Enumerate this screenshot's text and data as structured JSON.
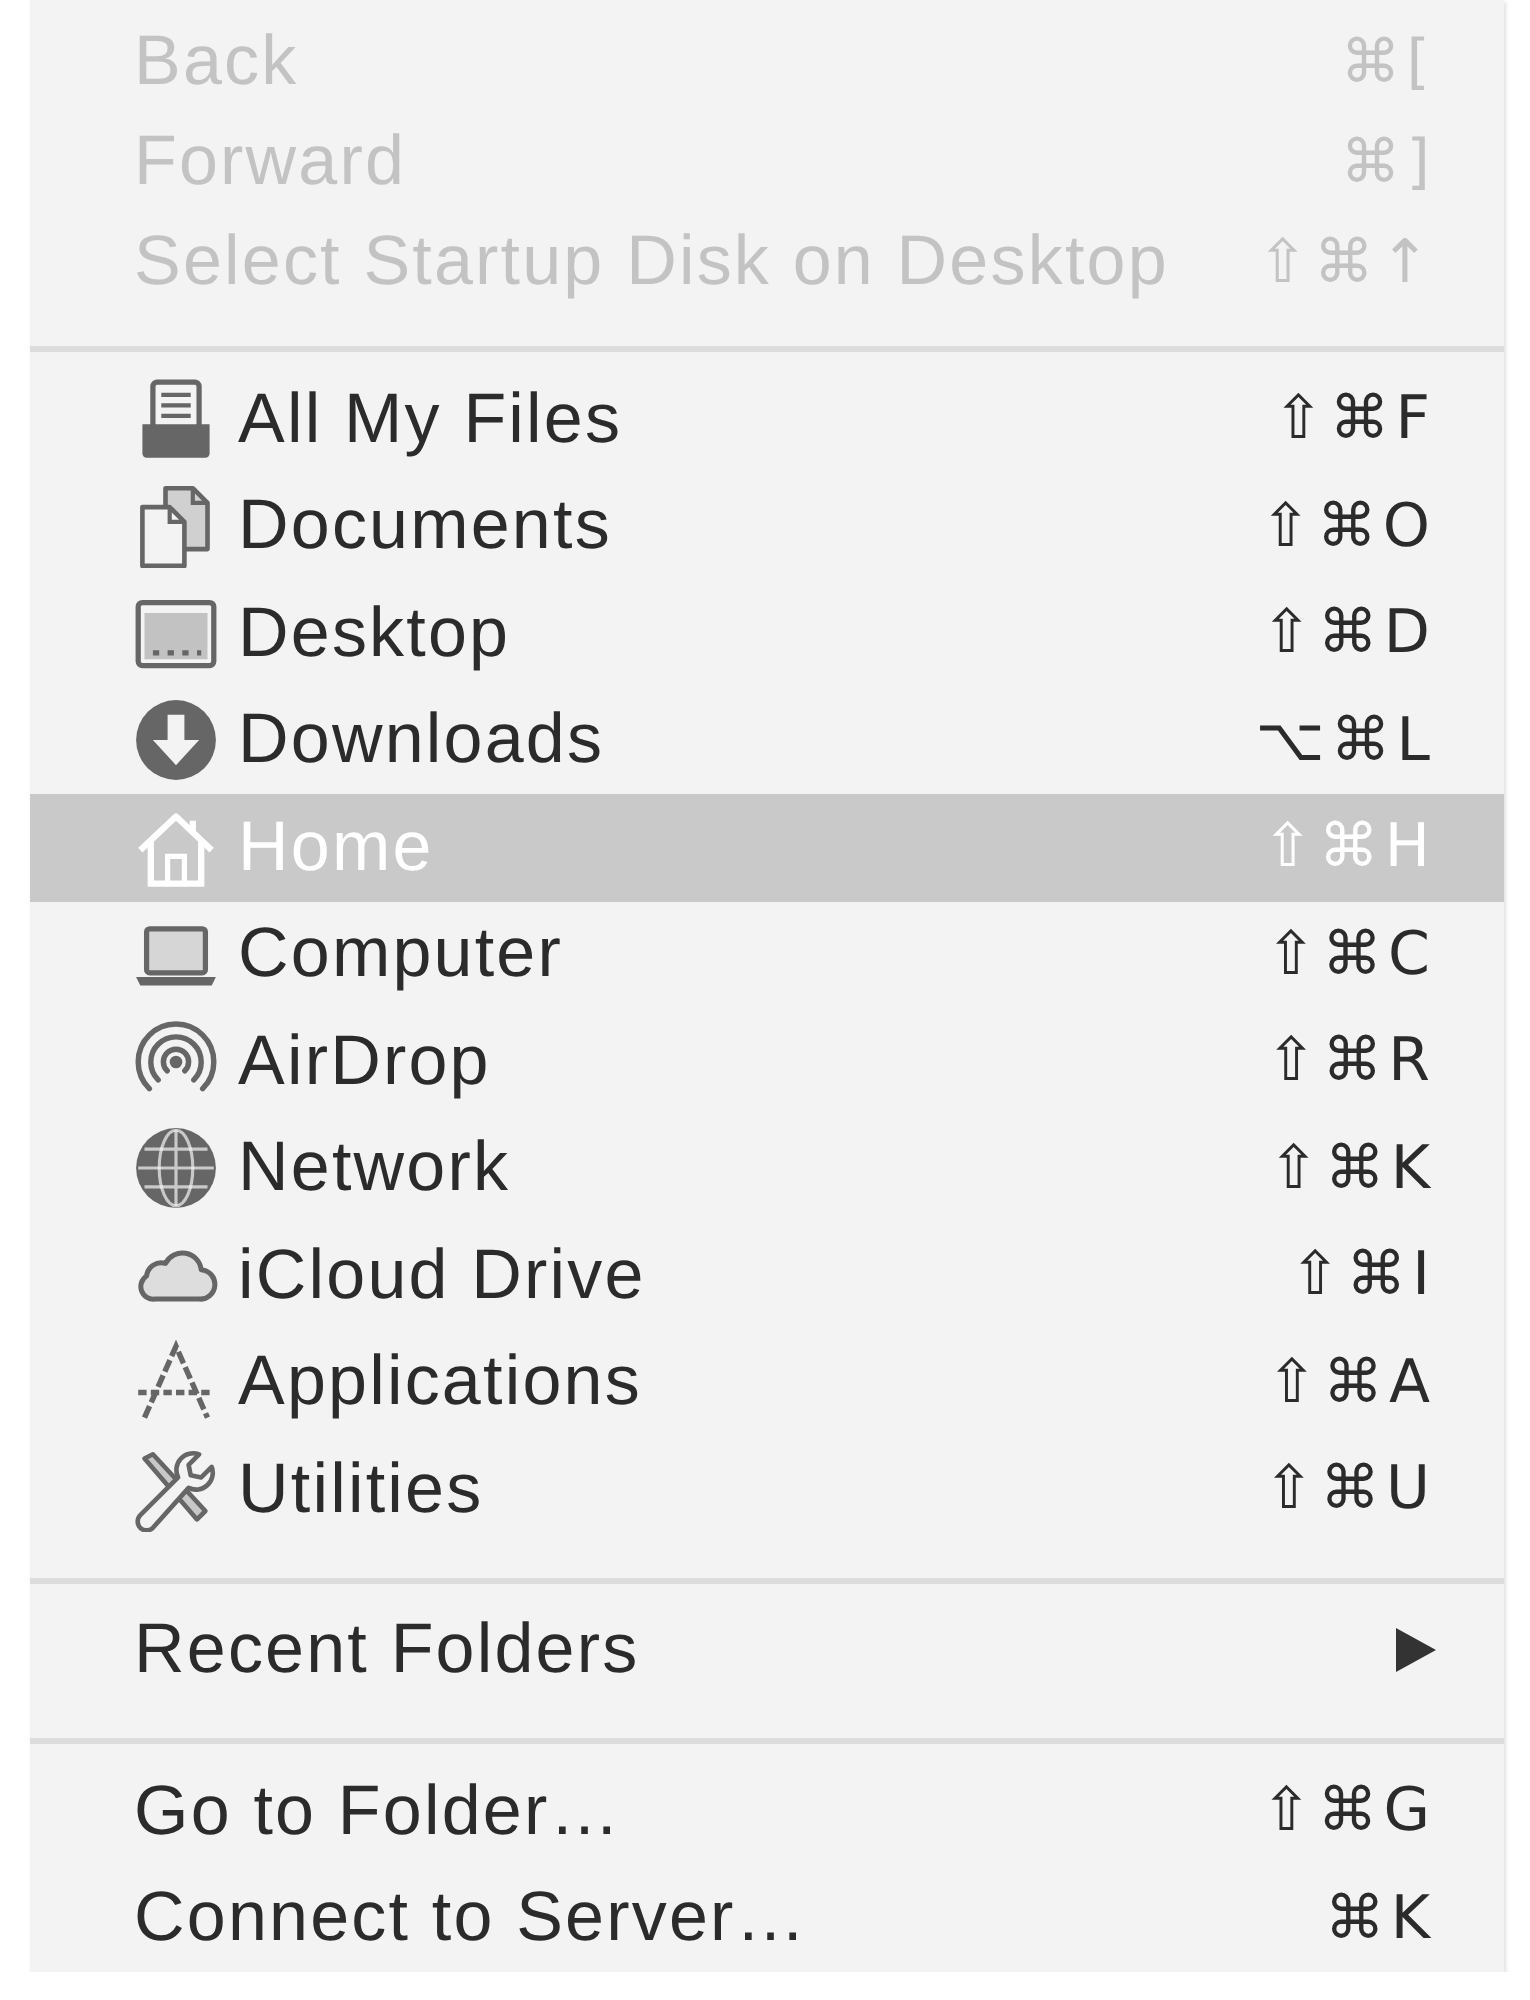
{
  "menu": {
    "sections": [
      {
        "items": [
          {
            "kind": "plain",
            "label": "Back",
            "shortcut": "⌘[",
            "disabled": true,
            "selected": false
          },
          {
            "kind": "plain",
            "label": "Forward",
            "shortcut": "⌘]",
            "disabled": true,
            "selected": false
          },
          {
            "kind": "plain",
            "label": "Select Startup Disk on Desktop",
            "shortcut": "⇧⌘↑",
            "disabled": true,
            "selected": false
          }
        ]
      },
      {
        "items": [
          {
            "kind": "place",
            "label": "All My Files",
            "shortcut": "⇧⌘F",
            "disabled": false,
            "selected": false
          },
          {
            "kind": "place",
            "label": "Documents",
            "shortcut": "⇧⌘O",
            "disabled": false,
            "selected": false
          },
          {
            "kind": "place",
            "label": "Desktop",
            "shortcut": "⇧⌘D",
            "disabled": false,
            "selected": false
          },
          {
            "kind": "place",
            "label": "Downloads",
            "shortcut": "⌥⌘L",
            "disabled": false,
            "selected": false
          },
          {
            "kind": "place",
            "label": "Home",
            "shortcut": "⇧⌘H",
            "disabled": false,
            "selected": true
          },
          {
            "kind": "place",
            "label": "Computer",
            "shortcut": "⇧⌘C",
            "disabled": false,
            "selected": false
          },
          {
            "kind": "place",
            "label": "AirDrop",
            "shortcut": "⇧⌘R",
            "disabled": false,
            "selected": false
          },
          {
            "kind": "place",
            "label": "Network",
            "shortcut": "⇧⌘K",
            "disabled": false,
            "selected": false
          },
          {
            "kind": "place",
            "label": "iCloud Drive",
            "shortcut": "⇧⌘I",
            "disabled": false,
            "selected": false
          },
          {
            "kind": "place",
            "label": "Applications",
            "shortcut": "⇧⌘A",
            "disabled": false,
            "selected": false
          },
          {
            "kind": "place",
            "label": "Utilities",
            "shortcut": "⇧⌘U",
            "disabled": false,
            "selected": false
          }
        ]
      },
      {
        "items": [
          {
            "kind": "submenu",
            "label": "Recent Folders",
            "disabled": false,
            "selected": false
          }
        ]
      },
      {
        "items": [
          {
            "kind": "plain",
            "label": "Go to Folder…",
            "shortcut": "⇧⌘G",
            "disabled": false,
            "selected": false
          },
          {
            "kind": "plain",
            "label": "Connect to Server…",
            "shortcut": "⌘K",
            "disabled": false,
            "selected": false
          }
        ]
      }
    ]
  }
}
